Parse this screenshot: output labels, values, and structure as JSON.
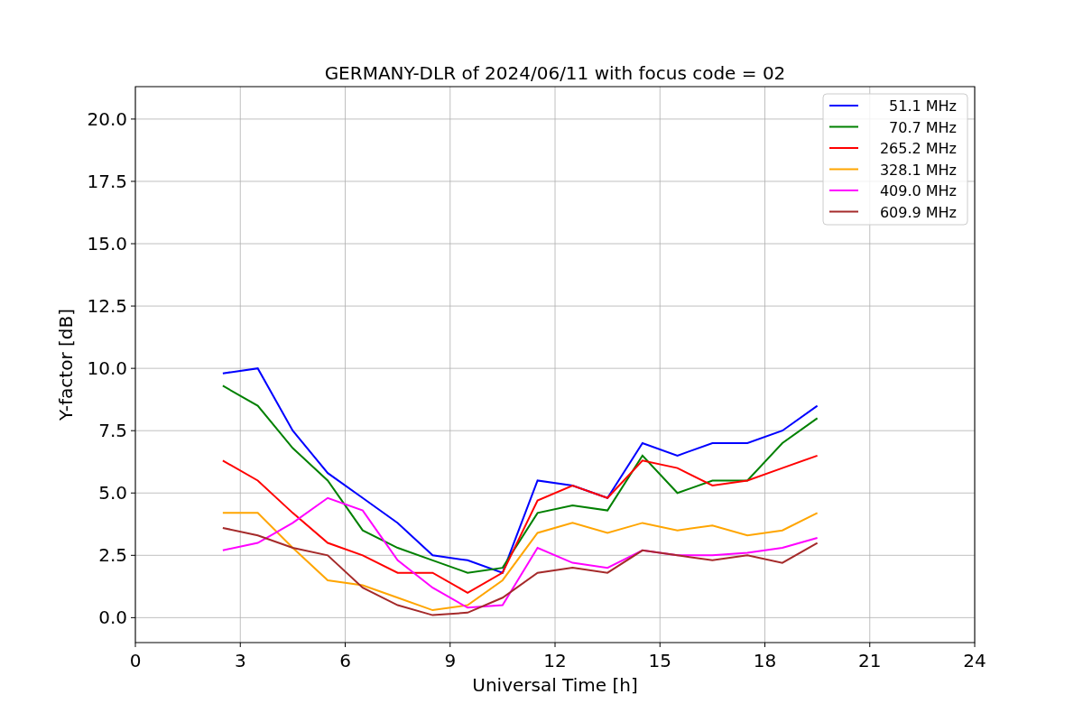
{
  "chart_data": {
    "type": "line",
    "title": "GERMANY-DLR of 2024/06/11 with focus code = 02",
    "xlabel": "Universal Time [h]",
    "ylabel": "Y-factor [dB]",
    "x": [
      2.5,
      3.5,
      4.5,
      5.5,
      6.5,
      7.5,
      8.5,
      9.5,
      10.5,
      11.5,
      12.5,
      13.5,
      14.5,
      15.5,
      16.5,
      17.5,
      18.5,
      19.5
    ],
    "series": [
      {
        "name": "51.1 MHz",
        "color": "#0000ff",
        "values": [
          9.8,
          10,
          7.5,
          5.8,
          4.8,
          3.8,
          2.5,
          2.3,
          1.8,
          5.5,
          5.3,
          4.8,
          7,
          6.5,
          7,
          7,
          7.5,
          8.5
        ]
      },
      {
        "name": "70.7 MHz",
        "color": "#008000",
        "values": [
          9.3,
          8.5,
          6.8,
          5.5,
          3.5,
          2.8,
          2.3,
          1.8,
          2,
          4.2,
          4.5,
          4.3,
          6.5,
          5,
          5.5,
          5.5,
          7,
          8
        ]
      },
      {
        "name": "265.2 MHz",
        "color": "#ff0000",
        "values": [
          6.3,
          5.5,
          4.2,
          3,
          2.5,
          1.8,
          1.8,
          1,
          1.8,
          4.7,
          5.3,
          4.8,
          6.3,
          6,
          5.3,
          5.5,
          6,
          6.5
        ]
      },
      {
        "name": "328.1 MHz",
        "color": "#ffa500",
        "values": [
          4.2,
          4.2,
          2.8,
          1.5,
          1.3,
          0.8,
          0.3,
          0.5,
          1.5,
          3.4,
          3.8,
          3.4,
          3.8,
          3.5,
          3.7,
          3.3,
          3.5,
          4.2
        ]
      },
      {
        "name": "409.0 MHz",
        "color": "#ff00ff",
        "values": [
          2.7,
          3,
          3.8,
          4.8,
          4.3,
          2.3,
          1.2,
          0.4,
          0.5,
          2.8,
          2.2,
          2,
          2.7,
          2.5,
          2.5,
          2.6,
          2.8,
          3.2
        ]
      },
      {
        "name": "609.9 MHz",
        "color": "#a52a2a",
        "values": [
          3.6,
          3.3,
          2.8,
          2.5,
          1.2,
          0.5,
          0.1,
          0.2,
          0.8,
          1.8,
          2,
          1.8,
          2.7,
          2.5,
          2.3,
          2.5,
          2.2,
          3
        ]
      }
    ],
    "grid": true,
    "legend": true,
    "xlim": [
      0,
      24
    ],
    "ylim": [
      -1.0,
      21.3
    ],
    "xticks": [
      0,
      3,
      6,
      9,
      12,
      15,
      18,
      21,
      24
    ],
    "yticks": [
      {
        "value": 0,
        "label": "0.0"
      },
      {
        "value": 2.5,
        "label": "2.5"
      },
      {
        "value": 5,
        "label": "5.0"
      },
      {
        "value": 7.5,
        "label": "7.5"
      },
      {
        "value": 10,
        "label": "10.0"
      },
      {
        "value": 12.5,
        "label": "12.5"
      },
      {
        "value": 15,
        "label": "15.0"
      },
      {
        "value": 17.5,
        "label": "17.5"
      },
      {
        "value": 20,
        "label": "20.0"
      }
    ]
  }
}
